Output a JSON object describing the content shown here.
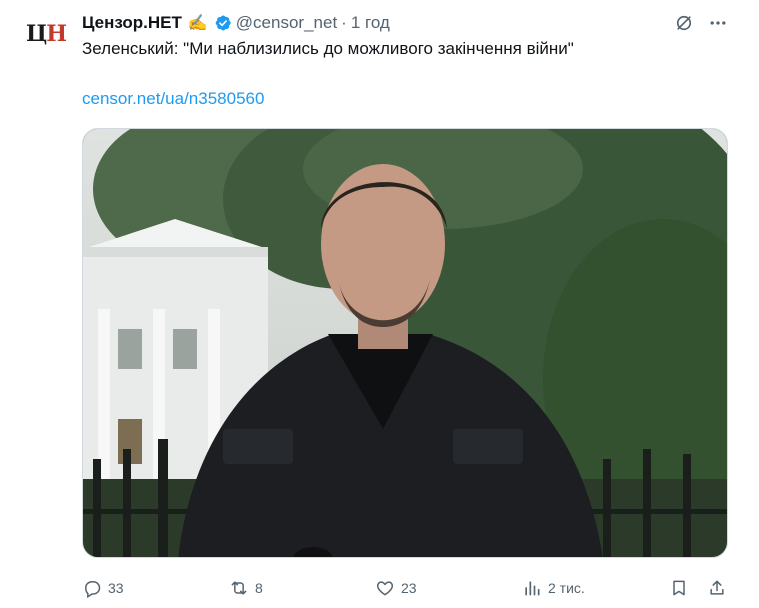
{
  "tweet": {
    "avatar_text_1": "Ц",
    "avatar_text_2": "Н",
    "author_name": "Цензор.НЕТ",
    "author_emoji": "✍️",
    "handle": "@censor_net",
    "separator": "·",
    "time": "1 год",
    "text": "Зеленський: \"Ми наблизились до можливого закінчення війни\"",
    "link": "censor.net/ua/n3580560"
  },
  "actions": {
    "replies": "33",
    "reposts": "8",
    "likes": "23",
    "views": "2 тис."
  },
  "colors": {
    "accent": "#1d9bf0",
    "muted": "#536471",
    "verified": "#1d9bf0"
  },
  "icons": [
    "grok-icon",
    "more-icon",
    "verified-icon",
    "reply-icon",
    "repost-icon",
    "like-icon",
    "views-icon",
    "bookmark-icon",
    "share-icon"
  ]
}
